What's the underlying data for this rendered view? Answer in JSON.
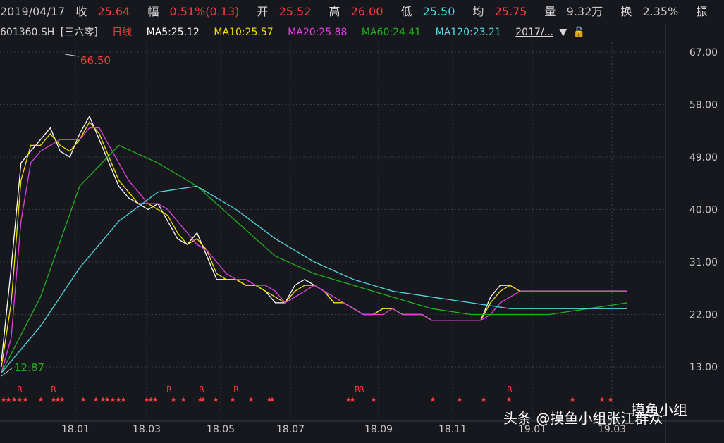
{
  "header": {
    "date": "2019/04/17",
    "close_label": "收",
    "close_value": "25.64",
    "change_label": "幅",
    "change_value": "0.51%(0.13)",
    "open_label": "开",
    "open_value": "25.52",
    "high_label": "高",
    "high_value": "26.00",
    "low_label": "低",
    "low_value": "25.50",
    "avg_label": "均",
    "avg_value": "25.75",
    "volume_label": "量",
    "volume_value": "9.32万",
    "turnover_label": "换",
    "turnover_value": "2.35%",
    "amplitude_label": "振"
  },
  "ma_bar": {
    "code": "601360.SH",
    "name": "[三六零]",
    "period": "日线",
    "ma5": "MA5:25.12",
    "ma10": "MA10:25.57",
    "ma20": "MA20:25.88",
    "ma60": "MA60:24.41",
    "ma120": "MA120:23.21",
    "range_select": "2017/..."
  },
  "colors": {
    "background": "#16181d",
    "up": "#ff3b3b",
    "down": "#3fe0e0",
    "ma5": "#ffffff",
    "ma10": "#f0e000",
    "ma20": "#e040e0",
    "ma60": "#20b020",
    "ma120": "#50d8e0",
    "grid": "#3a3d45"
  },
  "chart_data": {
    "type": "line",
    "y_ticks": [
      "67.00",
      "58.00",
      "49.00",
      "40.00",
      "31.00",
      "22.00",
      "13.00"
    ],
    "y_tick_values": [
      67,
      58,
      49,
      40,
      31,
      22,
      13
    ],
    "x_tick_labels": [
      "18.01",
      "18.03",
      "18.05",
      "18.07",
      "18.09",
      "18.11",
      "19.01",
      "19.03"
    ],
    "max_annotation": "66.50",
    "min_annotation": "12.87",
    "series": [
      {
        "name": "MA5",
        "x": [
          0,
          5,
          10,
          15,
          20,
          25,
          30,
          35,
          40,
          45,
          50,
          55,
          60,
          65,
          70,
          75,
          80,
          85,
          90,
          95,
          100,
          105,
          110,
          115,
          120,
          125,
          130,
          135,
          140,
          145,
          150,
          155,
          160,
          165,
          170,
          175,
          180,
          185,
          190,
          195,
          200,
          205,
          210,
          215,
          220,
          225,
          230,
          235,
          240,
          245,
          250,
          255,
          260,
          265,
          270,
          275,
          280,
          285,
          290,
          295,
          300,
          305,
          310,
          315,
          320
        ],
        "values": [
          14,
          30,
          48,
          50,
          52,
          54,
          50,
          49,
          53,
          56,
          52,
          48,
          44,
          42,
          41,
          40,
          41,
          38,
          35,
          34,
          36,
          32,
          28,
          28,
          28,
          27,
          27,
          26,
          24,
          24,
          27,
          28,
          27,
          26,
          24,
          24,
          23,
          22,
          22,
          23,
          23,
          22,
          22,
          22,
          21,
          21,
          21,
          21,
          21,
          21,
          25,
          27,
          27,
          26,
          26,
          26,
          26,
          26,
          26,
          26,
          26,
          26,
          26,
          26,
          26
        ]
      },
      {
        "name": "MA10",
        "x": [
          0,
          5,
          10,
          15,
          20,
          25,
          30,
          35,
          40,
          45,
          50,
          55,
          60,
          65,
          70,
          75,
          80,
          85,
          90,
          95,
          100,
          105,
          110,
          115,
          120,
          125,
          130,
          135,
          140,
          145,
          150,
          155,
          160,
          165,
          170,
          175,
          180,
          185,
          190,
          195,
          200,
          205,
          210,
          215,
          220,
          225,
          230,
          235,
          240,
          245,
          250,
          255,
          260,
          265,
          270,
          275,
          280,
          285,
          290,
          295,
          300,
          305,
          310,
          315,
          320
        ],
        "values": [
          13,
          24,
          45,
          51,
          51,
          53,
          51,
          50,
          52,
          55,
          53,
          49,
          45,
          43,
          41,
          41,
          40,
          39,
          36,
          34,
          35,
          33,
          29,
          28,
          28,
          27,
          27,
          26,
          25,
          24,
          26,
          27,
          27,
          26,
          24,
          24,
          23,
          22,
          22,
          23,
          23,
          22,
          22,
          22,
          21,
          21,
          21,
          21,
          21,
          21,
          24,
          26,
          27,
          26,
          26,
          26,
          26,
          26,
          26,
          26,
          26,
          26,
          26,
          26,
          26
        ]
      },
      {
        "name": "MA20",
        "x": [
          0,
          5,
          10,
          15,
          20,
          25,
          30,
          35,
          40,
          45,
          50,
          55,
          60,
          65,
          70,
          75,
          80,
          85,
          90,
          95,
          100,
          105,
          110,
          115,
          120,
          125,
          130,
          135,
          140,
          145,
          150,
          155,
          160,
          165,
          170,
          175,
          180,
          185,
          190,
          195,
          200,
          205,
          210,
          215,
          220,
          225,
          230,
          235,
          240,
          245,
          250,
          255,
          260,
          265,
          270,
          275,
          280,
          285,
          290,
          295,
          300,
          305,
          310,
          315,
          320
        ],
        "values": [
          12,
          18,
          38,
          48,
          50,
          51,
          52,
          52,
          52,
          54,
          54,
          51,
          48,
          45,
          43,
          41,
          41,
          40,
          38,
          36,
          34,
          33,
          31,
          29,
          28,
          28,
          27,
          27,
          26,
          24,
          25,
          26,
          27,
          26,
          25,
          24,
          23,
          22,
          22,
          22,
          23,
          22,
          22,
          22,
          21,
          21,
          21,
          21,
          21,
          21,
          22,
          24,
          25,
          26,
          26,
          26,
          26,
          26,
          26,
          26,
          26,
          26,
          26,
          26,
          26
        ]
      },
      {
        "name": "MA60",
        "x": [
          0,
          20,
          40,
          60,
          80,
          100,
          120,
          140,
          160,
          180,
          200,
          220,
          240,
          260,
          280,
          300,
          320
        ],
        "values": [
          12,
          25,
          44,
          51,
          48,
          44,
          38,
          32,
          29,
          27,
          25,
          23,
          22,
          22,
          22,
          23,
          24
        ]
      },
      {
        "name": "MA120",
        "x": [
          0,
          20,
          40,
          60,
          80,
          100,
          120,
          140,
          160,
          180,
          200,
          220,
          240,
          260,
          280,
          300,
          320
        ],
        "values": [
          12,
          20,
          30,
          38,
          43,
          44,
          40,
          35,
          31,
          28,
          26,
          25,
          24,
          23,
          23,
          23,
          23
        ]
      }
    ]
  },
  "watermark": {
    "text1": "头条 @摸鱼小组张江群众",
    "text2": "摸鱼小组"
  }
}
